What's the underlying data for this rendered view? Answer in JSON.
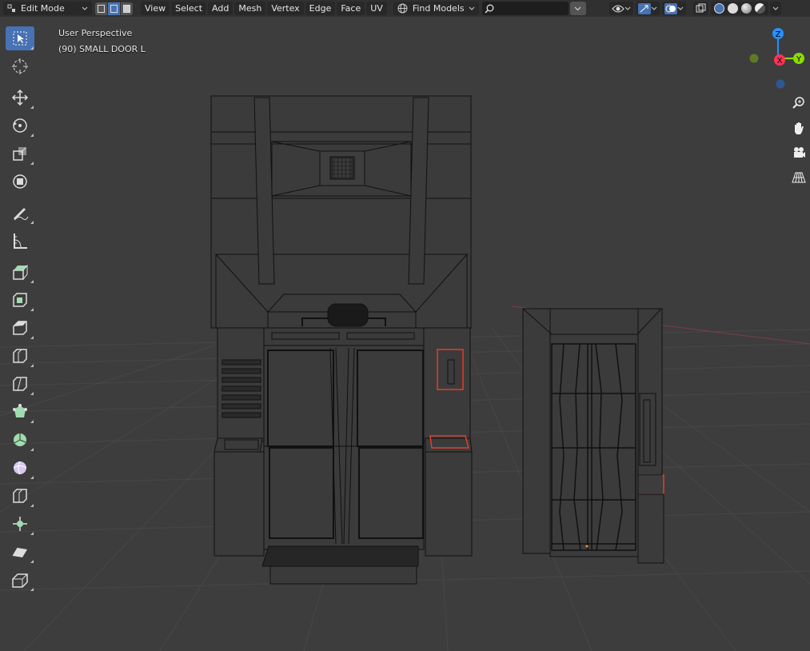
{
  "header": {
    "mode_label": "Edit Mode",
    "menus": [
      "View",
      "Select",
      "Add",
      "Mesh",
      "Vertex",
      "Edge",
      "Face",
      "UV"
    ],
    "find_models_label": "Find Models",
    "search_value": ""
  },
  "viewport": {
    "perspective_label": "User Perspective",
    "object_label": "(90) SMALL DOOR L"
  },
  "gizmo": {
    "z": "Z",
    "x": "X",
    "y": "Y"
  },
  "colors": {
    "accent": "#4772b3",
    "axis_x": "#ff3352",
    "axis_y": "#8bdc00",
    "axis_z": "#2890ff",
    "selected_edge": "#e0402f",
    "viewport_bg": "#3d3d3d"
  },
  "toolbar": {
    "tools": [
      "select-box-icon",
      "cursor-icon",
      "move-icon",
      "rotate-icon",
      "scale-icon",
      "transform-icon",
      "annotate-icon",
      "measure-icon",
      "extrude-icon",
      "inset-icon",
      "bevel-icon",
      "loop-cut-icon",
      "knife-icon",
      "poly-build-icon",
      "spin-icon",
      "smooth-icon",
      "edge-slide-icon",
      "shrink-fatten-icon",
      "shear-icon",
      "rip-icon"
    ]
  }
}
